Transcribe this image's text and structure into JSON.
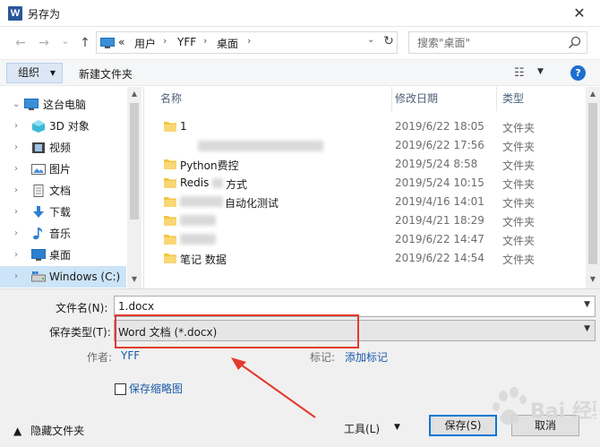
{
  "window": {
    "icon_letter": "W",
    "title": "另存为",
    "close": "✕"
  },
  "nav": {
    "back": "←",
    "forward": "→",
    "recent": "⌄",
    "up": "↑",
    "breadcrumb": [
      "«",
      "用户",
      "YFF",
      "桌面"
    ],
    "search_placeholder": "搜索\"桌面\""
  },
  "toolbar": {
    "organize": "组织",
    "new_folder": "新建文件夹",
    "view_icon": "☷",
    "help": "?"
  },
  "sidebar": {
    "items": [
      {
        "label": "这台电脑",
        "icon": "pc-icon",
        "expanded": true
      },
      {
        "label": "3D 对象",
        "icon": "3d-objects-icon"
      },
      {
        "label": "视频",
        "icon": "video-icon"
      },
      {
        "label": "图片",
        "icon": "pictures-icon"
      },
      {
        "label": "文档",
        "icon": "documents-icon"
      },
      {
        "label": "下载",
        "icon": "download-icon"
      },
      {
        "label": "音乐",
        "icon": "music-icon"
      },
      {
        "label": "桌面",
        "icon": "desktop-icon"
      },
      {
        "label": "Windows (C:)",
        "icon": "drive-icon",
        "selected": true
      }
    ]
  },
  "columns": {
    "name": "名称",
    "date": "修改日期",
    "type": "类型"
  },
  "files": [
    {
      "name": "1",
      "date": "2019/6/22 18:05",
      "type": "文件夹"
    },
    {
      "name": "",
      "date": "2019/6/22 17:56",
      "type": "文件夹"
    },
    {
      "name": "Python费控",
      "date": "2019/5/24 8:58",
      "type": "文件夹"
    },
    {
      "name": "Redis",
      "name_tail": "方式",
      "date": "2019/5/24 10:15",
      "type": "文件夹"
    },
    {
      "name": "",
      "name_tail": "自动化测试",
      "date": "2019/4/16 14:01",
      "type": "文件夹"
    },
    {
      "name": "",
      "date": "2019/4/21 18:29",
      "type": "文件夹"
    },
    {
      "name": "",
      "date": "2019/6/22 14:47",
      "type": "文件夹"
    },
    {
      "name": "笔记 数据",
      "date": "2019/6/22 14:54",
      "type": "文件夹"
    }
  ],
  "form": {
    "filename_label": "文件名(N):",
    "filename_value": "1.docx",
    "type_label": "保存类型(T):",
    "type_value": "Word 文档 (*.docx)",
    "author_label": "作者:",
    "author_value": "YFF",
    "tags_label": "标记:",
    "tags_value": "添加标记",
    "thumbnail_label": "保存缩略图"
  },
  "footer": {
    "hide_folders": "隐藏文件夹",
    "tools": "工具(L)",
    "save": "保存(S)",
    "cancel": "取消"
  },
  "watermark": "Bai 经验",
  "colors": {
    "accent": "#0078d7",
    "highlight": "#e33a2d",
    "link": "#1a5aa8",
    "folder": "#f4c542"
  }
}
